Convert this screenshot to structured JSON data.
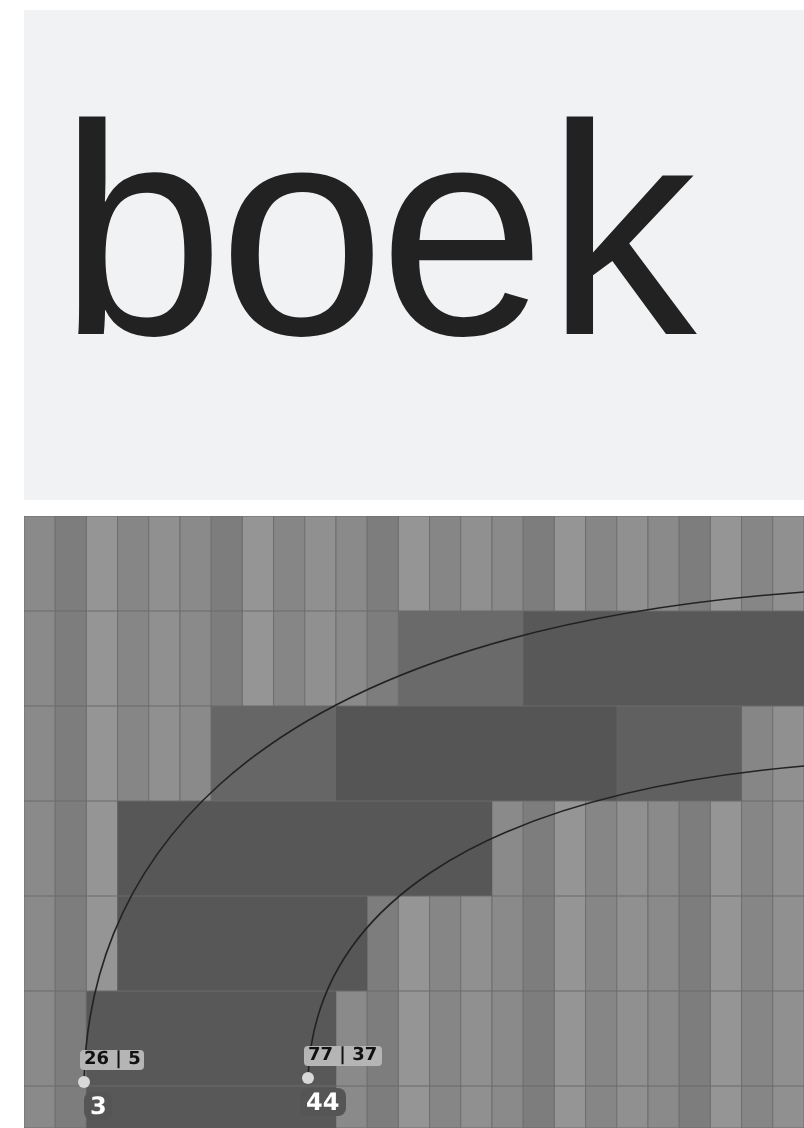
{
  "preview": {
    "text": "boek"
  },
  "glyph_editor": {
    "points": [
      {
        "number": "3",
        "coords": "26 | 5"
      },
      {
        "number": "44",
        "coords": "77 | 37"
      }
    ]
  }
}
